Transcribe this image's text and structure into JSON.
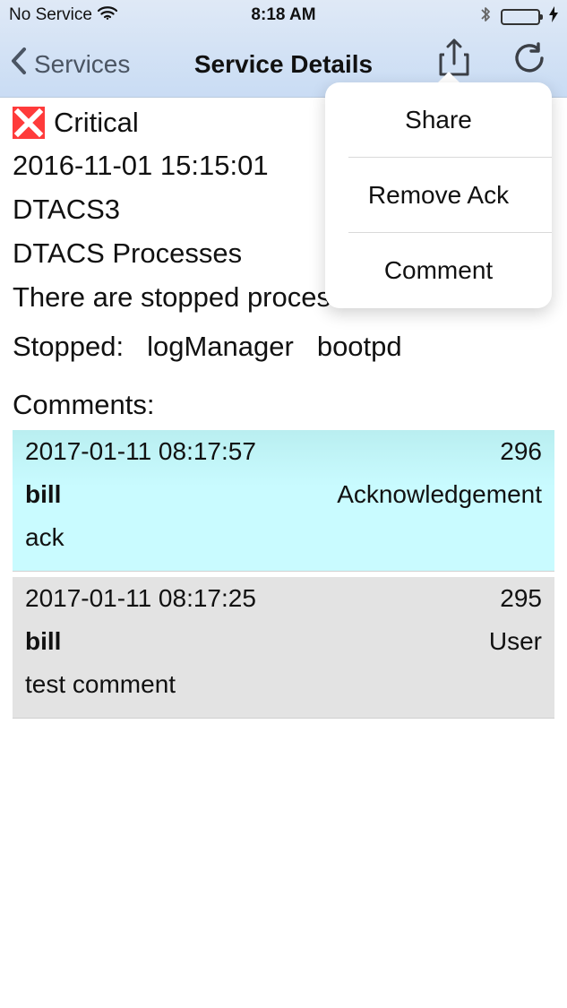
{
  "status_bar": {
    "carrier": "No Service",
    "time": "8:18 AM"
  },
  "nav": {
    "back_label": "Services",
    "title": "Service Details",
    "icons": {
      "back": "chevron-left-icon",
      "share": "share-icon",
      "refresh": "refresh-icon"
    }
  },
  "service": {
    "status_icon": "critical-icon",
    "status": "Critical",
    "timestamp": "2016-11-01 15:15:01",
    "host": "DTACS3",
    "service_name": "DTACS Processes",
    "message": "There are stopped processes",
    "stopped_label": "Stopped:",
    "stopped_items": [
      "logManager",
      "bootpd"
    ]
  },
  "comments": {
    "title": "Comments:",
    "items": [
      {
        "datetime": "2017-01-11 08:17:57",
        "id": "296",
        "author": "bill",
        "type": "Acknowledgement",
        "text": "ack",
        "highlight_color": "#c9fbff"
      },
      {
        "datetime": "2017-01-11 08:17:25",
        "id": "295",
        "author": "bill",
        "type": "User",
        "text": "test comment",
        "highlight_color": "#e3e3e3"
      }
    ]
  },
  "popover": {
    "items": [
      "Share",
      "Remove Ack",
      "Comment"
    ]
  },
  "colors": {
    "nav_gradient_top": "#dfe9f6",
    "nav_gradient_bottom": "#c9dcf4",
    "critical_red": "#ff3b3b",
    "battery_green": "#2ecc40"
  }
}
